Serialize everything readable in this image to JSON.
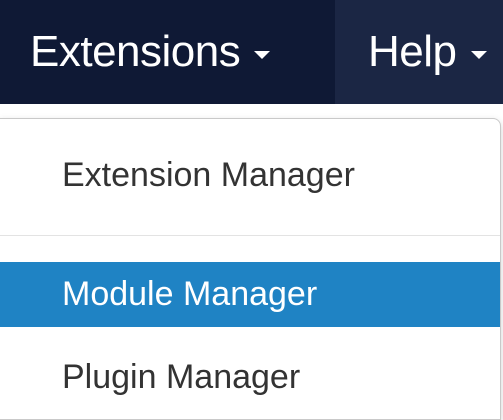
{
  "navbar": {
    "items": [
      {
        "label": "Extensions",
        "active": true
      },
      {
        "label": "Help",
        "active": false
      }
    ]
  },
  "dropdown": {
    "items": [
      {
        "label": "Extension Manager",
        "highlighted": false
      },
      {
        "label": "Module Manager",
        "highlighted": true
      },
      {
        "label": "Plugin Manager",
        "highlighted": false
      }
    ]
  },
  "colors": {
    "navbar_bg": "#1b2644",
    "active_nav_bg": "#0f1935",
    "highlight": "#1f83c4",
    "menu_text": "#333333"
  }
}
